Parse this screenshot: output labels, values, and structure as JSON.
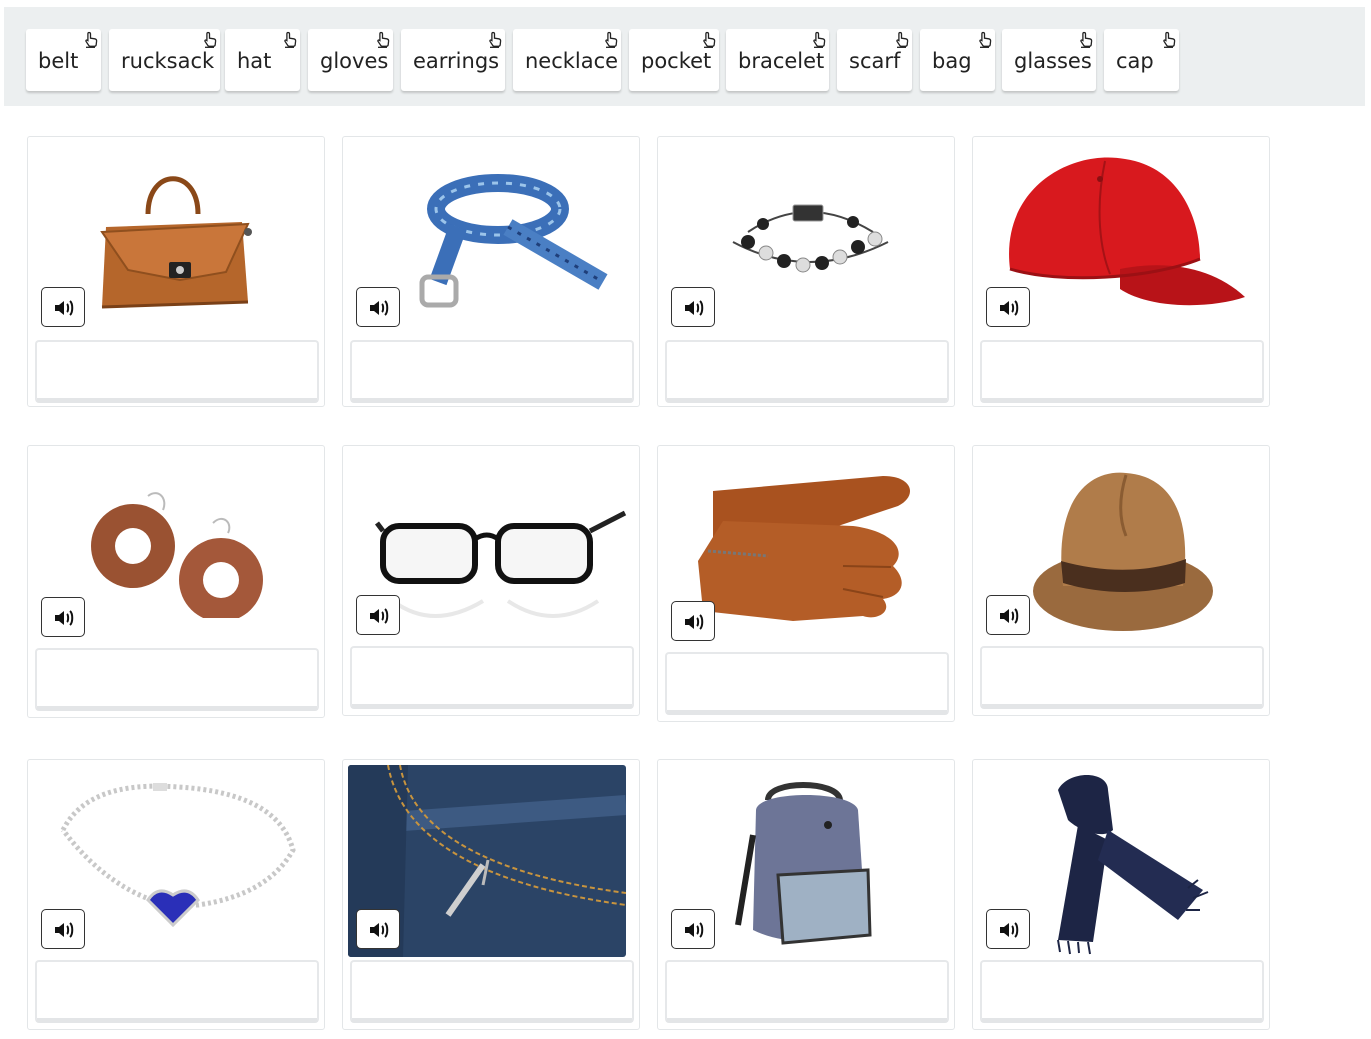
{
  "word_bank": {
    "words": [
      "belt",
      "rucksack",
      "hat",
      "gloves",
      "earrings",
      "necklace",
      "pocket",
      "bracelet",
      "scarf",
      "bag",
      "glasses",
      "cap"
    ]
  },
  "icons": {
    "drag": "hand-pointer-icon",
    "audio": "speaker-volume-icon"
  },
  "cards": [
    {
      "picture": "bag",
      "answer": ""
    },
    {
      "picture": "belt",
      "answer": ""
    },
    {
      "picture": "bracelet",
      "answer": ""
    },
    {
      "picture": "cap",
      "answer": ""
    },
    {
      "picture": "earrings",
      "answer": ""
    },
    {
      "picture": "glasses",
      "answer": ""
    },
    {
      "picture": "gloves",
      "answer": ""
    },
    {
      "picture": "hat",
      "answer": ""
    },
    {
      "picture": "necklace",
      "answer": ""
    },
    {
      "picture": "pocket",
      "answer": ""
    },
    {
      "picture": "rucksack",
      "answer": ""
    },
    {
      "picture": "scarf",
      "answer": ""
    }
  ],
  "colors": {
    "word_bank_bg": "#eceff0",
    "cap_red": "#d8191e",
    "leather_brown": "#b5662b",
    "denim_blue": "#2b4466",
    "scarf_navy": "#1d2545"
  }
}
